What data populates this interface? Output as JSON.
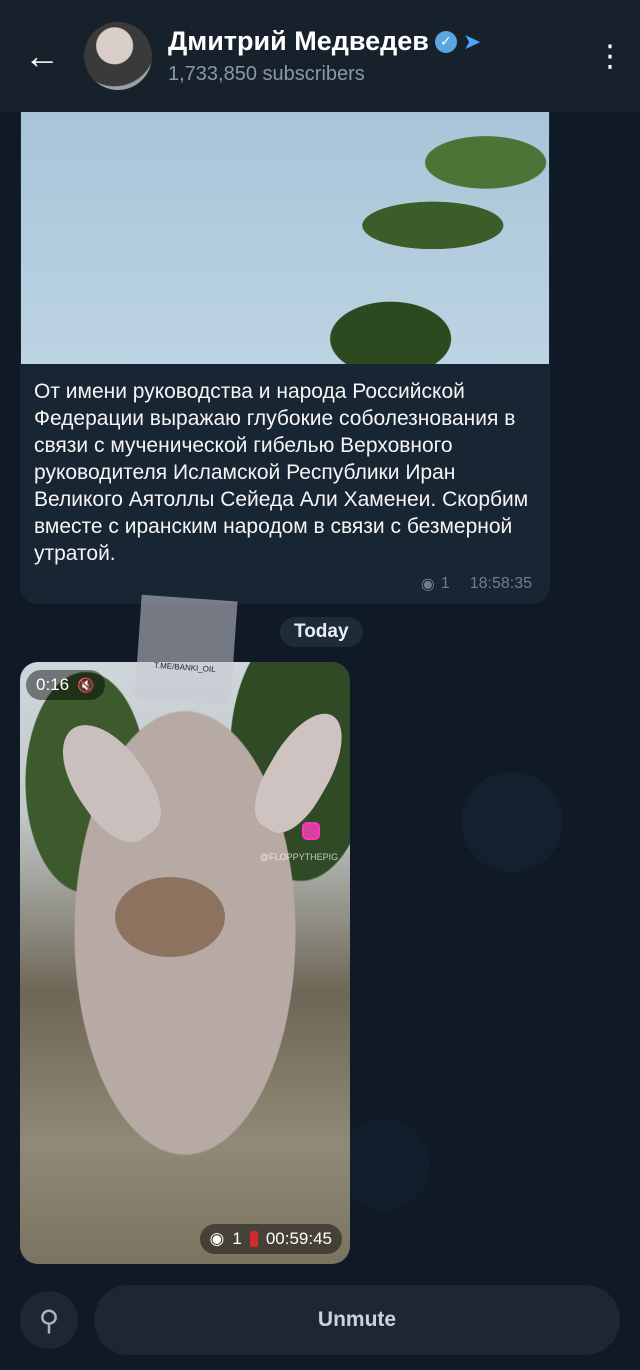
{
  "header": {
    "back_icon": "arrow-left-icon",
    "channel_name": "Дмитрий Медведев",
    "subscribers": "1,733,850 subscribers",
    "verified_icon": "verified-badge-icon",
    "telegram_icon": "telegram-plane-icon",
    "more_icon": "kebab-menu-icon"
  },
  "messages": [
    {
      "text": "От имени руководства и народа Российской Федерации выражаю глубокие соболезнования в связи с мученической гибелью Верховного руководителя Исламской Республики Иран Великого Аятоллы Сейеда Али Хаменеи. Скорбим вместе с иранским народом в связи с безмерной утратой.",
      "views": "1",
      "time": "18:58:35"
    },
    {
      "date_separator": "Today",
      "video_duration": "0:16",
      "watermark": "T.ME/BANKI_OIL",
      "instagram_handle": "@FLOPPYTHEPIG",
      "views": "1",
      "time": "00:59:45"
    }
  ],
  "bottom": {
    "search_icon": "search-icon",
    "unmute_label": "Unmute"
  },
  "colors": {
    "background": "#0e1621",
    "header": "#17212b",
    "bubble": "#182533",
    "accent": "#4ea4f6"
  }
}
